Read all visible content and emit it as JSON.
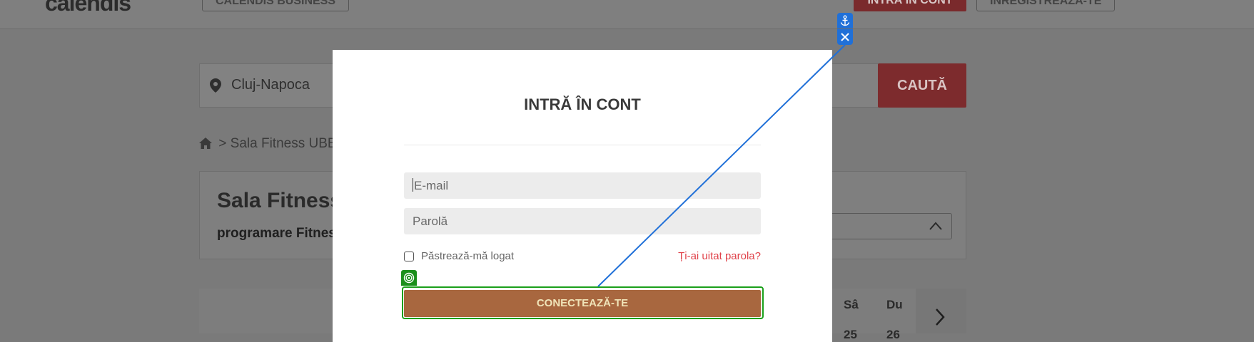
{
  "header": {
    "logo_text": "calendis",
    "logo_icon": "bookmark-icon",
    "business_button": "CALENDIS BUSINESS",
    "login_button": "INTRĂ ÎN CONT",
    "register_button": "ÎNREGISTREAZĂ-TE"
  },
  "search": {
    "icon": "map-pin-icon",
    "city": "Cluj-Napoca",
    "button": "CAUTĂ"
  },
  "breadcrumb": {
    "icon": "home-icon",
    "text": "> Sala Fitness UBB"
  },
  "venue": {
    "title": "Sala Fitness",
    "subtitle": "programare Fitnes"
  },
  "calendar": {
    "days": [
      "Sâ",
      "Du"
    ],
    "numbers": [
      "25",
      "26"
    ],
    "next_icon": "chevron-right-icon"
  },
  "modal": {
    "title": "INTRĂ ÎN CONT",
    "email_placeholder": "E-mail",
    "password_placeholder": "Parolă",
    "remember_label": "Păstrează-mă logat",
    "forgot_link": "Ți-ai uitat parola?",
    "submit_button": "CONECTEAZĂ-TE"
  },
  "overlay": {
    "anchor_icon": "anchor-icon",
    "close_icon": "close-icon",
    "target_icon": "target-icon"
  },
  "colors": {
    "accent_red": "#e0434b",
    "submit_bg": "#a8673f",
    "highlight_green": "#1aa01a",
    "annotation_blue": "#2070d8"
  }
}
